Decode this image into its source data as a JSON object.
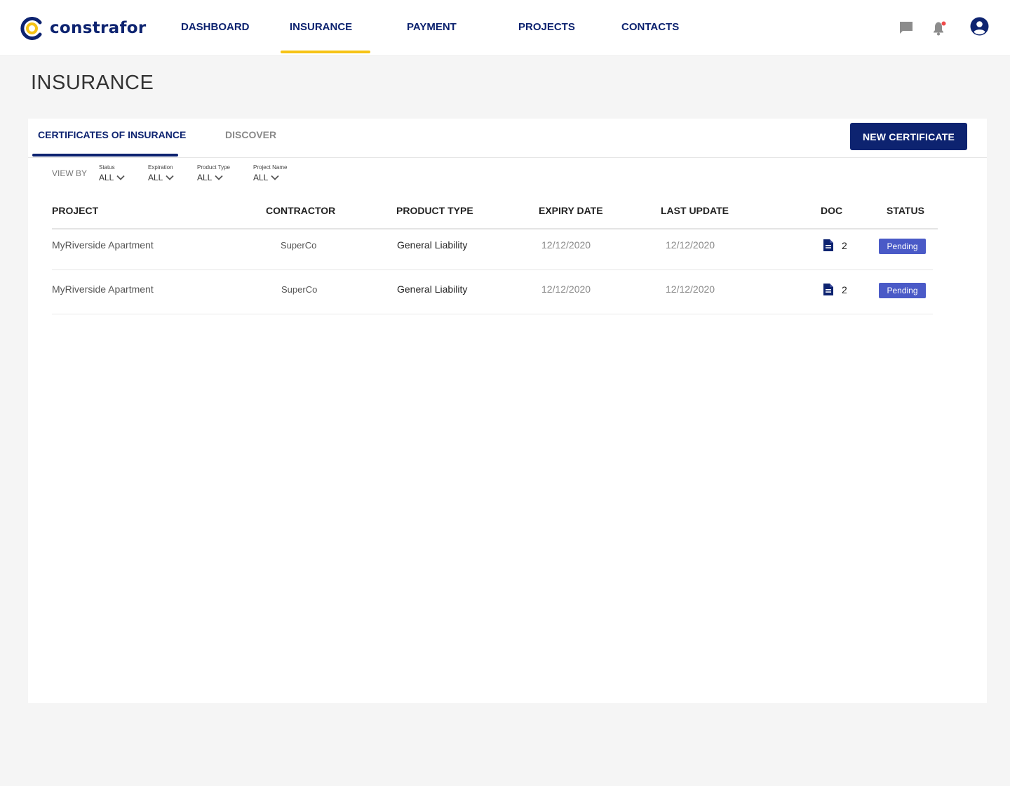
{
  "brand": {
    "name": "constrafor",
    "accent": "#f6c316",
    "primary": "#0d2370"
  },
  "nav": {
    "items": [
      {
        "label": "DASHBOARD"
      },
      {
        "label": "INSURANCE"
      },
      {
        "label": "PAYMENT"
      },
      {
        "label": "PROJECTS"
      },
      {
        "label": "CONTACTS"
      }
    ],
    "active": "INSURANCE",
    "icons": [
      "chat-icon",
      "bell-icon",
      "account-icon"
    ]
  },
  "page": {
    "title": "INSURANCE"
  },
  "tabs": [
    {
      "label": "CERTIFICATES OF INSURANCE"
    },
    {
      "label": "DISCOVER"
    }
  ],
  "actions": {
    "new_certificate": "NEW CERTIFICATE"
  },
  "filters": {
    "view_by": "VIEW BY",
    "items": [
      {
        "label": "Status",
        "value": "ALL"
      },
      {
        "label": "Expiration",
        "value": "ALL"
      },
      {
        "label": "Product Type",
        "value": "ALL"
      },
      {
        "label": "Project Name",
        "value": "ALL"
      }
    ]
  },
  "table": {
    "columns": [
      "PROJECT",
      "CONTRACTOR",
      "PRODUCT TYPE",
      "EXPIRY DATE",
      "LAST UPDATE",
      "DOC",
      "STATUS"
    ],
    "rows": [
      {
        "project": "MyRiverside Apartment",
        "contractor": "SuperCo",
        "product_type": "General Liability",
        "expiry_date": "12/12/2020",
        "last_update": "12/12/2020",
        "doc": "2",
        "status": "Pending"
      },
      {
        "project": "MyRiverside Apartment",
        "contractor": "SuperCo",
        "product_type": "General Liability",
        "expiry_date": "12/12/2020",
        "last_update": "12/12/2020",
        "doc": "2",
        "status": "Pending"
      }
    ]
  }
}
